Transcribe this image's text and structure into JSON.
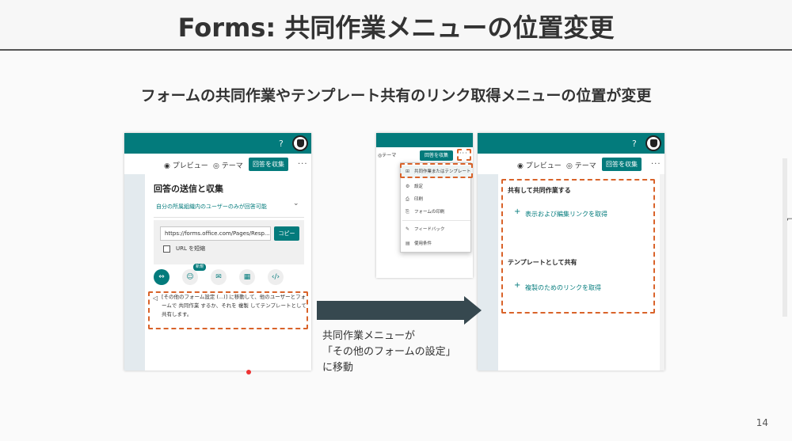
{
  "slide": {
    "title": "Forms: 共同作業メニューの位置変更",
    "subtitle": "フォームの共同作業やテンプレート共有のリンク取得メニューの位置が変更",
    "page_number": "14",
    "caption_lines": [
      "共同作業メニューが",
      "「その他のフォームの設定」",
      "に移動"
    ]
  },
  "colors": {
    "brand_teal": "#037b7c",
    "highlight_dashed": "#d9632a",
    "arrow": "#36484f"
  },
  "panel_left": {
    "help": "?",
    "toolbar": {
      "preview": "プレビュー",
      "theme": "テーマ",
      "collect": "回答を収集",
      "more": "···"
    },
    "heading": "回答の送信と収集",
    "scope": "自分の所属組織内のユーザーのみが回答可能",
    "url": "https://forms.office.com/Pages/Resp...",
    "copy": "コピー",
    "shorten_url": "URL を短縮",
    "new_badge": "新規",
    "share_icons": [
      "link-icon",
      "qr-person-icon",
      "mail-icon",
      "qr-code-icon",
      "embed-icon"
    ],
    "notice": "[その他のフォーム設定 (...)] に移動して、他のユーザーとフォームで 共同作業 するか、それを 複製 してテンプレートとして共有します。"
  },
  "panel_middle": {
    "toolbar": {
      "theme": "テーマ",
      "collect": "回答を収集",
      "more": "···"
    },
    "menu": [
      "共同作業またはテンプレート",
      "設定",
      "印刷",
      "フォームの印刷",
      "フィードバック",
      "使用条件"
    ]
  },
  "panel_right": {
    "help": "?",
    "toolbar": {
      "preview": "プレビュー",
      "theme": "テーマ",
      "collect": "回答を収集",
      "more": "···"
    },
    "section1_title": "共有して共同作業する",
    "section1_link": "表示および編集リンクを取得",
    "section2_title": "テンプレートとして共有",
    "section2_link": "複製のためのリンクを取得"
  }
}
